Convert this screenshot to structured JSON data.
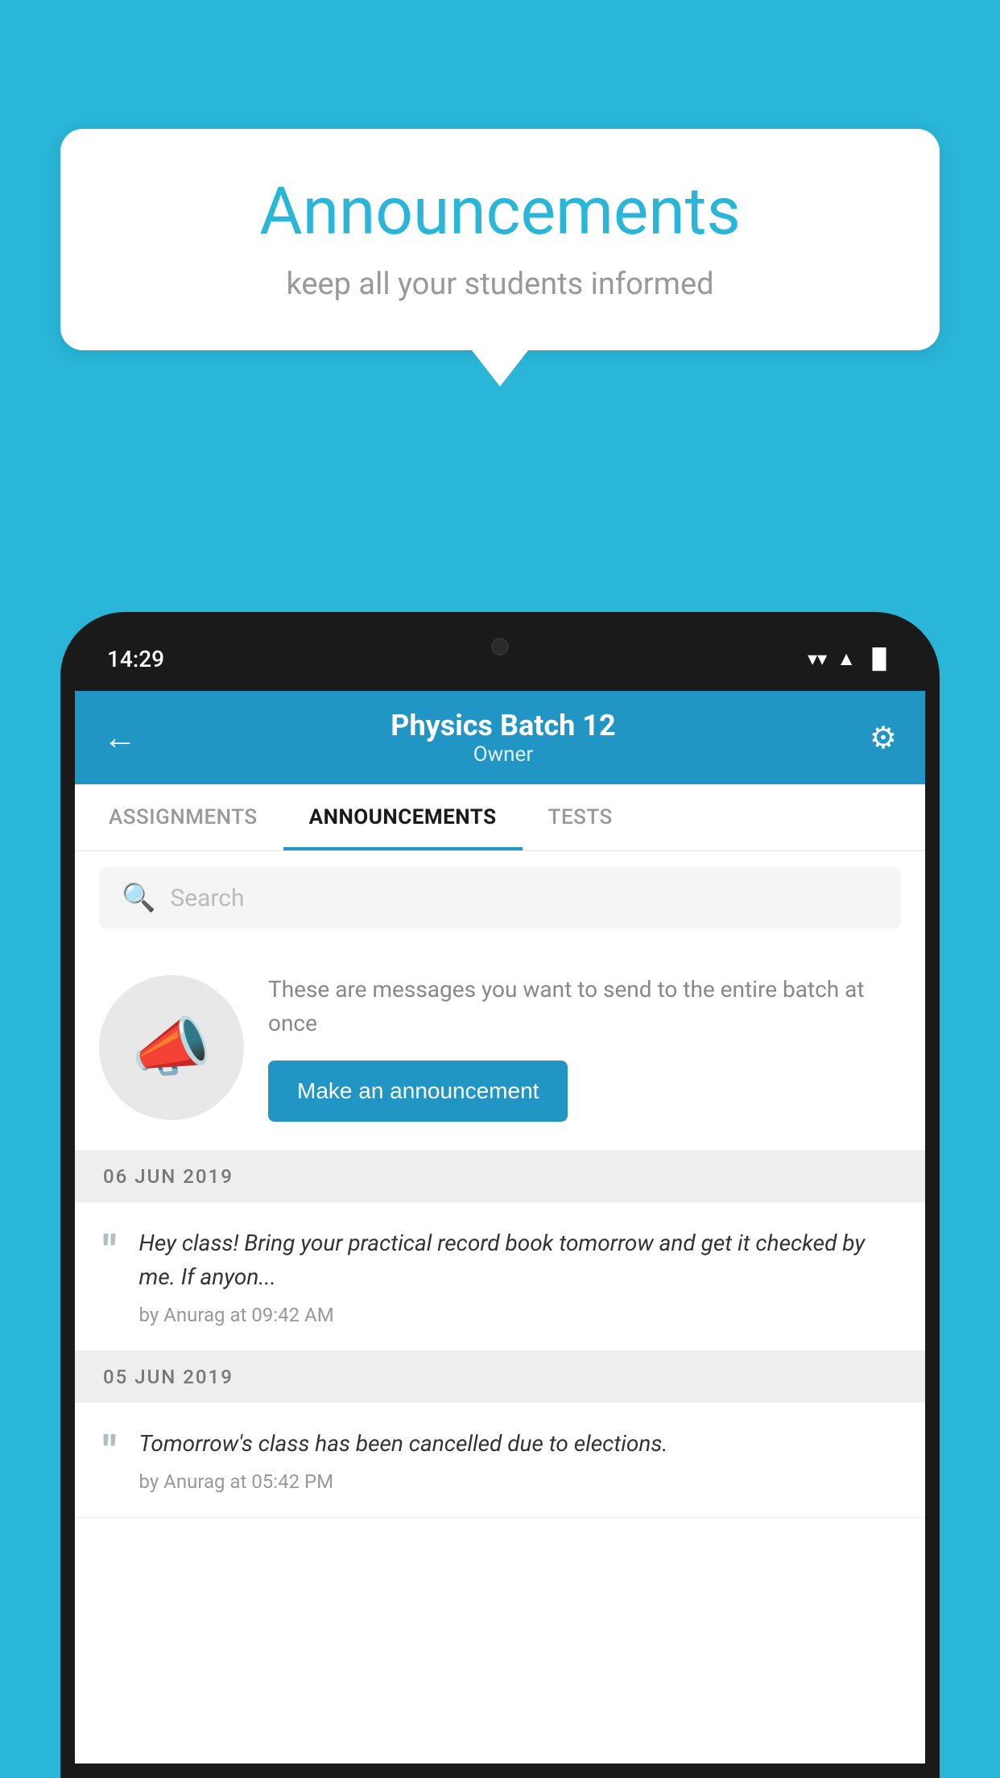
{
  "background": {
    "color": "#29b6d8"
  },
  "speech_bubble": {
    "title": "Announcements",
    "subtitle": "keep all your students informed"
  },
  "phone": {
    "status_bar": {
      "time": "14:29",
      "signal_icon": "▲",
      "wifi_icon": "▼",
      "battery_icon": "▐"
    },
    "header": {
      "back_label": "←",
      "title": "Physics Batch 12",
      "subtitle": "Owner",
      "settings_icon": "⚙"
    },
    "tabs": [
      {
        "label": "ASSIGNMENTS",
        "active": false
      },
      {
        "label": "ANNOUNCEMENTS",
        "active": true
      },
      {
        "label": "TESTS",
        "active": false
      }
    ],
    "search": {
      "placeholder": "Search"
    },
    "announcement_prompt": {
      "description": "These are messages you want to send to the entire batch at once",
      "button_label": "Make an announcement"
    },
    "announcements": [
      {
        "date": "06  JUN  2019",
        "text": "Hey class! Bring your practical record book tomorrow and get it checked by me. If anyon...",
        "meta": "by Anurag at 09:42 AM"
      },
      {
        "date": "05  JUN  2019",
        "text": "Tomorrow's class has been cancelled due to elections.",
        "meta": "by Anurag at 05:42 PM"
      }
    ]
  }
}
